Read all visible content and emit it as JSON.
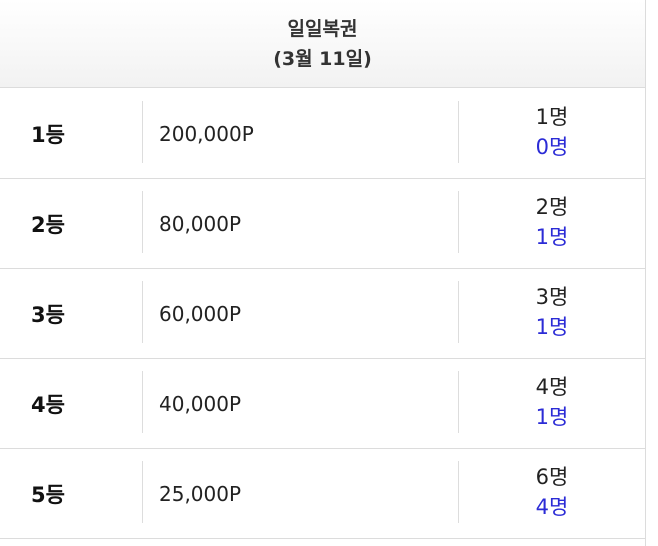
{
  "header": {
    "title": "일일복권",
    "date": "(3월 11일)"
  },
  "rows": [
    {
      "rank": "1등",
      "prize": "200,000P",
      "total": "1명",
      "winners": "0명"
    },
    {
      "rank": "2등",
      "prize": "80,000P",
      "total": "2명",
      "winners": "1명"
    },
    {
      "rank": "3등",
      "prize": "60,000P",
      "total": "3명",
      "winners": "1명"
    },
    {
      "rank": "4등",
      "prize": "40,000P",
      "total": "4명",
      "winners": "1명"
    },
    {
      "rank": "5등",
      "prize": "25,000P",
      "total": "6명",
      "winners": "4명"
    }
  ],
  "colors": {
    "winner_count": "#2b2bd6",
    "border": "#dcdcdc"
  }
}
